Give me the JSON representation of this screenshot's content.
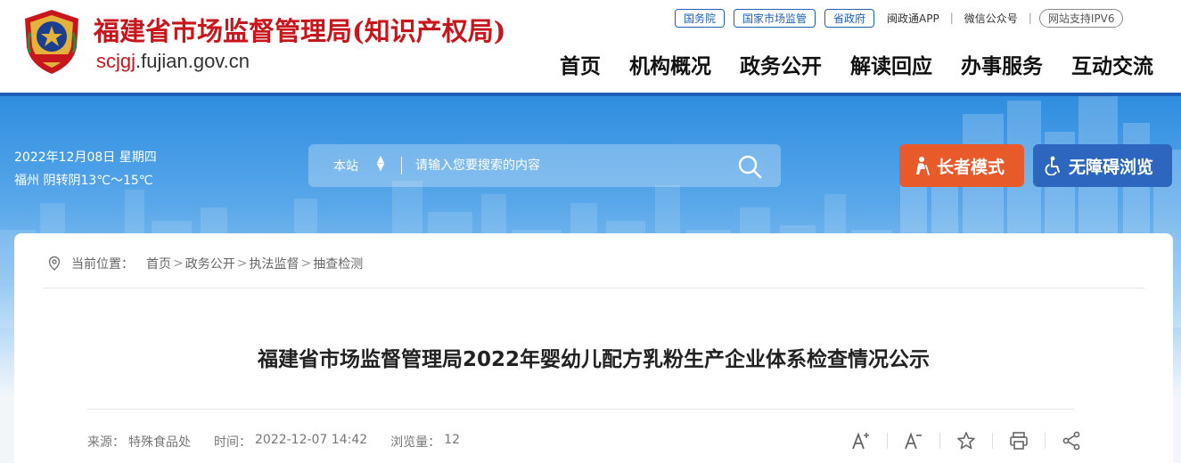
{
  "header": {
    "title": "福建省市场监督管理局(知识产权局)",
    "domain_prefix": "scjgj",
    "domain_suffix": ".fujian.gov.cn",
    "top_links": [
      "国务院",
      "国家市场监管",
      "省政府"
    ],
    "app_link": "闽政通APP",
    "wechat_link": "微信公众号",
    "ipv6_badge": "网站支持IPV6",
    "nav": [
      "首页",
      "机构概况",
      "政务公开",
      "解读回应",
      "办事服务",
      "互动交流"
    ],
    "colors": {
      "brand_red": "#c8161d",
      "brand_blue": "#1f5fb7"
    }
  },
  "banner": {
    "date": "2022年12月08日 星期四",
    "weather": "福州 阴转阴13℃～15℃",
    "search": {
      "scope": "本站",
      "placeholder": "请输入您要搜索的内容",
      "icon": "search-icon"
    },
    "elder_mode": {
      "label": "长者模式",
      "icon": "elder-icon",
      "color": "#e85a2a"
    },
    "accessible": {
      "label": "无障碍浏览",
      "icon": "wheelchair-icon",
      "color": "#2d66bf"
    }
  },
  "article": {
    "breadcrumb": {
      "label": "当前位置：",
      "items": [
        "首页",
        "政务公开",
        "执法监督",
        "抽查检测"
      ],
      "separator": ">"
    },
    "title": "福建省市场监督管理局2022年婴幼儿配方乳粉生产企业体系检查情况公示",
    "source_label": "来源：",
    "source": "特殊食品处",
    "time_label": "时间：",
    "time": "2022-12-07 14:42",
    "views_label": "浏览量：",
    "views": "12",
    "tools": [
      "font-increase-icon",
      "font-decrease-icon",
      "star-icon",
      "print-icon",
      "share-icon"
    ]
  }
}
